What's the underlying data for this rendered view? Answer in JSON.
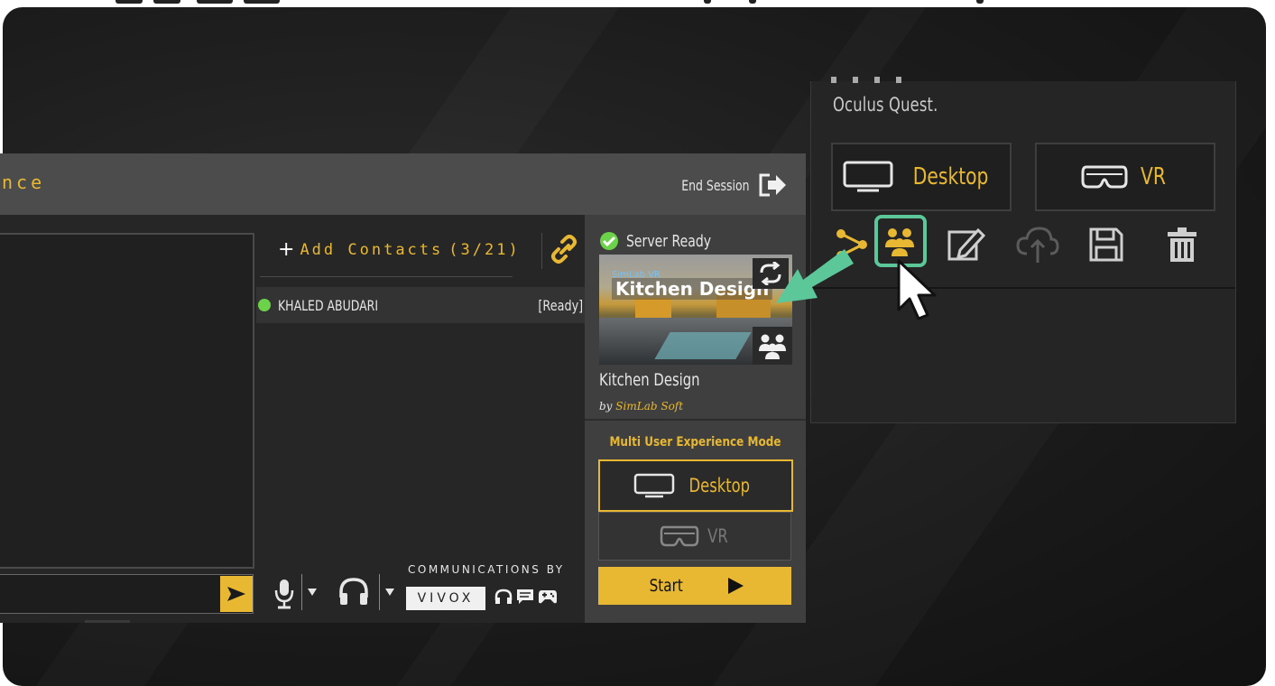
{
  "dialog": {
    "title_partial": "nce",
    "end_session_label": "End Session"
  },
  "contacts": {
    "add_label": "Add Contacts",
    "count": "(3/21)",
    "items": [
      {
        "name": "KHALED ABUDARI",
        "status": "[Ready]"
      }
    ]
  },
  "audio": {
    "caption": "COMMUNICATIONS BY",
    "brand": "VIVOX"
  },
  "server": {
    "status": "Server Ready"
  },
  "project": {
    "thumbnail_small": "SimLab VR",
    "thumbnail_title": "Kitchen Design",
    "name": "Kitchen Design",
    "by_prefix": "by",
    "author": "SimLab Soft"
  },
  "multi_user": {
    "heading": "Multi User Experience Mode",
    "desktop_label": "Desktop",
    "vr_label": "VR",
    "start_label": "Start"
  },
  "right_panel": {
    "description": "Oculus Quest.",
    "desktop_label": "Desktop",
    "vr_label": "VR",
    "icons": [
      "share-icon",
      "multi-user-icon",
      "edit-icon",
      "upload-icon",
      "save-icon",
      "delete-icon"
    ]
  },
  "colors": {
    "accent": "#e8b833",
    "ready_green": "#6cd24a",
    "highlight_teal": "#5cc89a"
  }
}
